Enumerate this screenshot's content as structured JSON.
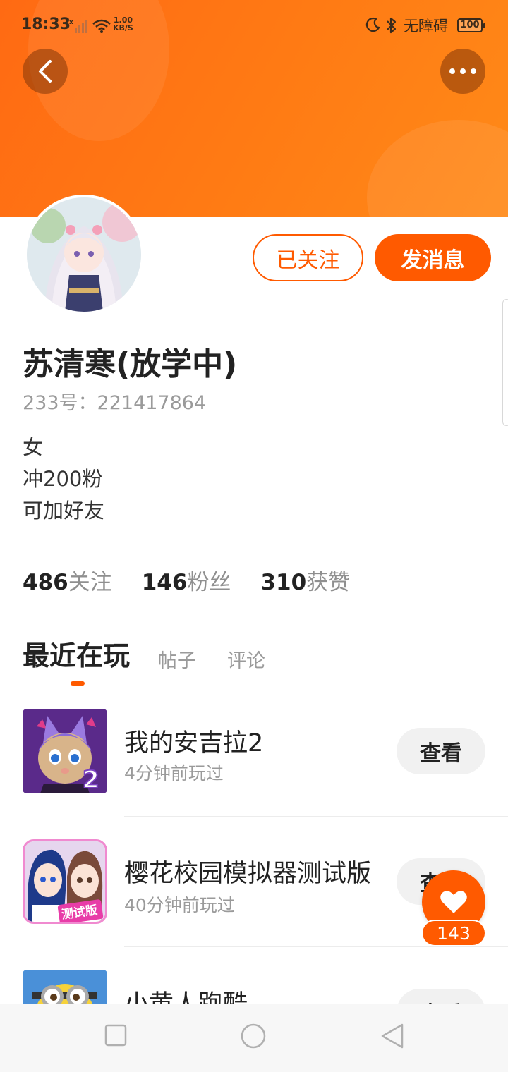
{
  "status_bar": {
    "time": "18:33",
    "net_speed_value": "1.00",
    "net_speed_unit": "KB/S",
    "accessibility": "无障碍",
    "battery": "100"
  },
  "profile": {
    "follow_label": "已关注",
    "message_label": "发消息",
    "username": "苏清寒(放学中)",
    "user_id": "233号：221417864",
    "bio": [
      "女",
      "冲200粉",
      "可加好友"
    ],
    "stats": [
      {
        "num": "486",
        "label": "关注"
      },
      {
        "num": "146",
        "label": "粉丝"
      },
      {
        "num": "310",
        "label": "获赞"
      }
    ]
  },
  "tabs": [
    "最近在玩",
    "帖子",
    "评论"
  ],
  "games": [
    {
      "title": "我的安吉拉2",
      "time": "4分钟前玩过",
      "action": "查看"
    },
    {
      "title": "樱花校园模拟器测试版",
      "time": "40分钟前玩过",
      "action": "查看"
    },
    {
      "title": "小黄人跑酷",
      "time": "",
      "action": "查看"
    }
  ],
  "like": {
    "count": "143"
  },
  "game_icon_texts": {
    "angela_badge": "2",
    "sakura_badge": "测试版"
  },
  "colors": {
    "accent": "#ff5a00",
    "header": "#ff7414"
  }
}
